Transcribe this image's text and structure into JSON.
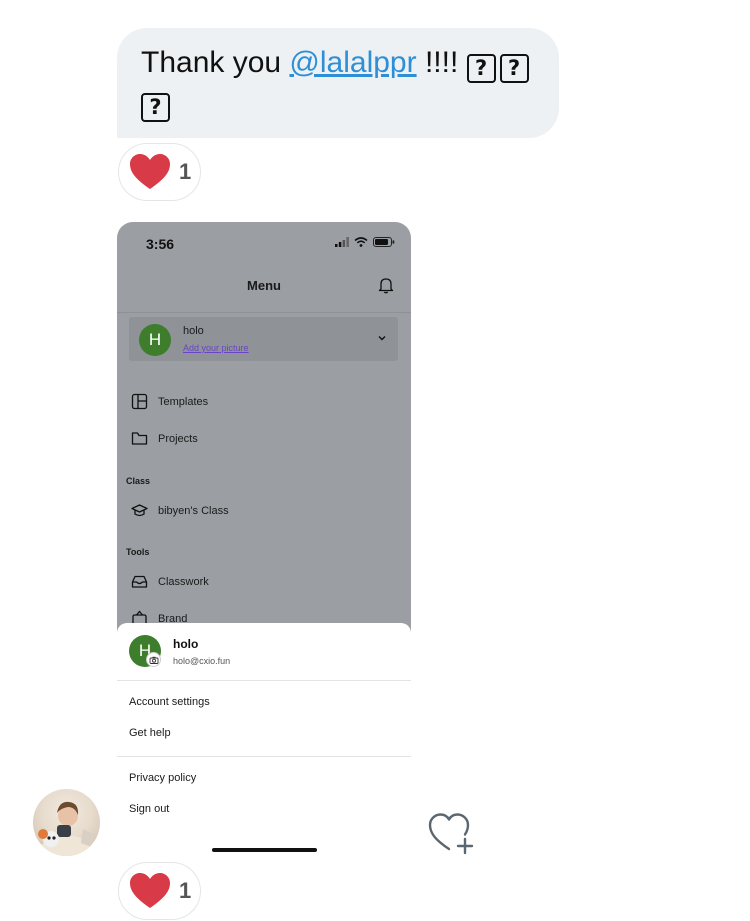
{
  "message": {
    "prefix": "Thank you ",
    "mention": "@lalalppr",
    "suffix": " !!!! ",
    "glyph": "?"
  },
  "reactions": [
    {
      "emoji": "heart",
      "count": "1"
    },
    {
      "emoji": "heart",
      "count": "1"
    }
  ],
  "screenshot": {
    "status_time": "3:56",
    "menu_title": "Menu",
    "user": {
      "initial": "H",
      "name": "holo",
      "add_picture": "Add your picture"
    },
    "items": {
      "templates": "Templates",
      "projects": "Projects",
      "class_section": "Class",
      "class_item": "bibyen's Class",
      "tools_section": "Tools",
      "classwork": "Classwork",
      "brand": "Brand"
    },
    "sheet": {
      "initial": "H",
      "name": "holo",
      "email": "holo@cxio.fun",
      "account_settings": "Account settings",
      "get_help": "Get help",
      "privacy_policy": "Privacy policy",
      "sign_out": "Sign out"
    }
  },
  "colors": {
    "mention": "#2f8fd6",
    "heart": "#d83a47",
    "bubble": "#eef1f3",
    "avatar_green": "#3d7d2c",
    "overlay": "#9b9ea3"
  },
  "icons": [
    "heart-icon",
    "heart-plus-icon",
    "bell-icon",
    "chevron-down-icon",
    "templates-icon",
    "folder-icon",
    "graduation-cap-icon",
    "inbox-icon",
    "brand-icon",
    "camera-icon",
    "signal-icon",
    "wifi-icon",
    "battery-icon"
  ]
}
